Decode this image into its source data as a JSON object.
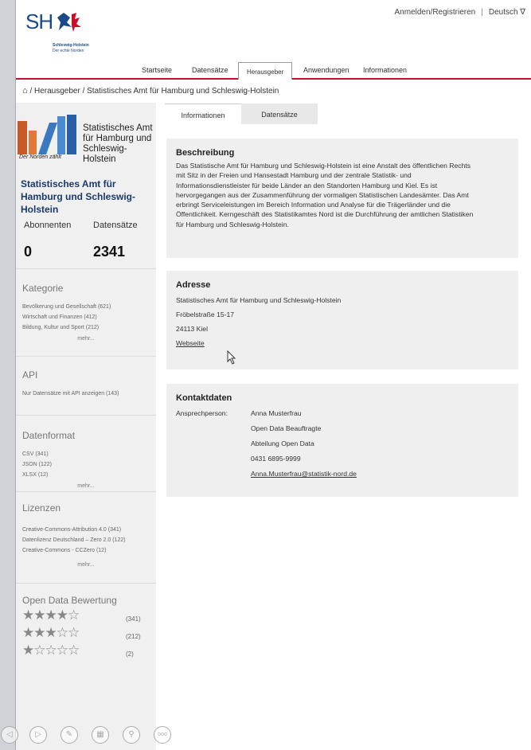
{
  "header": {
    "logo_letters": "SH",
    "logo_line1": "Schleswig-Holstein",
    "logo_line2": "Der echte Norden",
    "login": "Anmelden/Registrieren",
    "separator": "|",
    "language": "Deutsch ∇"
  },
  "nav": [
    "Startseite",
    "Datensätze",
    "Herausgeber",
    "Anwendungen",
    "Informationen"
  ],
  "breadcrumb": {
    "home_icon": "home-icon",
    "text": "/ Herausgeber / Statistisches Amt für Hamburg und Schleswig-Holstein"
  },
  "sidebar": {
    "org_logo_text": [
      "Statistisches Amt",
      "für Hamburg und",
      "Schleswig-Holstein"
    ],
    "org_logo_tagline": "Der Norden zählt",
    "org_name": "Statistisches Amt für Hamburg und Schleswig-Holstein",
    "stats": {
      "subscribers_label": "Abonnenten",
      "subscribers": "0",
      "datasets_label": "Datensätze",
      "datasets": "2341"
    },
    "kategorie": {
      "title": "Kategorie",
      "items": [
        "Bevölkerung und Gesellschaft (621)",
        "Wirtschaft und Finanzen (412)",
        "Bildung, Kultur und Sport (212)"
      ],
      "more": "mehr..."
    },
    "api": {
      "title": "API",
      "items": [
        "Nur Datensätze mit API anzeigen (143)"
      ]
    },
    "format": {
      "title": "Datenformat",
      "items": [
        "CSV (341)",
        "JSON (122)",
        "XLSX (12)"
      ],
      "more": "mehr..."
    },
    "lizenzen": {
      "title": "Lizenzen",
      "items": [
        "Creative-Commons-Attribution 4.0 (341)",
        "Datenlizenz Deutschland – Zero 2.0 (122)",
        "Creative-Commons - CCZero (12)"
      ],
      "more": "mehr..."
    },
    "rating": {
      "title": "Open Data Bewertung",
      "rows": [
        {
          "stars": 4,
          "count": "(341)"
        },
        {
          "stars": 3,
          "count": "(212)"
        },
        {
          "stars": 1,
          "count": "(2)"
        }
      ]
    }
  },
  "tabs": [
    "Informationen",
    "Datensätze"
  ],
  "beschreibung": {
    "title": "Beschreibung",
    "lines": [
      "Das Statistische Amt für Hamburg und Schleswig-Holstein ist eine Anstalt des öffentlichen Rechts",
      "mit Sitz in der Freien und Hansestadt Hamburg und der zentrale Statistik- und",
      "Informationsdienstleister für beide Länder an den Standorten Hamburg und Kiel. Es ist",
      "hervorgegangen aus der Zusammenführung der vormaligen Statistischen Landesämter. Das Amt",
      "erbringt Serviceleistungen im Bereich Information und Analyse für die Trägerländer und die",
      "Öffentlichkeit. Kerngeschäft des Statistikamtes Nord ist die Durchführung der amtlichen Statistiken",
      "für Hamburg und Schleswig-Holstein."
    ]
  },
  "adresse": {
    "title": "Adresse",
    "lines": [
      "Statistisches Amt für Hamburg und Schleswig-Holstein",
      "Fröbelstraße 15-17",
      "24113 Kiel"
    ],
    "link": "Webseite"
  },
  "kontakt": {
    "title": "Kontaktdaten",
    "label": "Ansprechperson:",
    "lines": [
      "Anna Musterfrau",
      "Open Data Beauftragte",
      "Abteilung Open Data",
      "0431 6895-9999"
    ],
    "email": "Anna.Musterfrau@statistik-nord.de"
  },
  "colors": {
    "accent": "#c8102e",
    "link": "#1a55a8",
    "org_name": "#1a3a6e"
  },
  "controls": [
    "back-icon",
    "forward-icon",
    "pen-icon",
    "grid-icon",
    "zoom-icon",
    "more-icon"
  ]
}
